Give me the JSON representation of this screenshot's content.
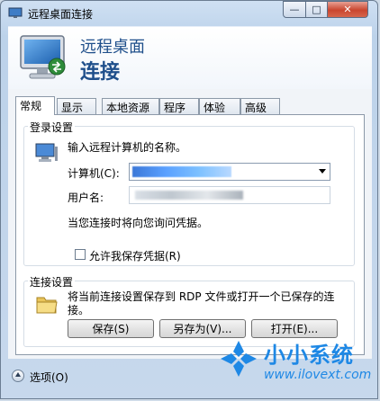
{
  "window": {
    "title": "远程桌面连接",
    "controls": {
      "minimize": "—",
      "maximize": "□",
      "close": "✕"
    }
  },
  "banner": {
    "line1": "远程桌面",
    "line2": "连接",
    "icon": "remote-desktop-monitor-icon"
  },
  "tabs": [
    {
      "label": "常规",
      "active": true
    },
    {
      "label": "显示",
      "active": false
    },
    {
      "label": "本地资源",
      "active": false
    },
    {
      "label": "程序",
      "active": false
    },
    {
      "label": "体验",
      "active": false
    },
    {
      "label": "高级",
      "active": false
    }
  ],
  "logon": {
    "group_label": "登录设置",
    "prompt": "输入远程计算机的名称。",
    "computer_label": "计算机(C):",
    "computer_value": "",
    "username_label": "用户名:",
    "username_value": "",
    "credentials_note": "当您连接时将向您询问凭据。",
    "allow_save_label": "允许我保存凭据(R)",
    "allow_save_checked": false
  },
  "connection": {
    "group_label": "连接设置",
    "description_line1": "将当前连接设置保存到 RDP 文件或打开一个已保存的连",
    "description_line2": "接。",
    "save_button": "保存(S)",
    "save_as_button": "另存为(V)...",
    "open_button": "打开(E)..."
  },
  "footer": {
    "options_label": "选项(O)"
  },
  "watermark": {
    "text": "小小系统",
    "url": "www.ilovext.com"
  },
  "colors": {
    "accent": "#1f4f8b",
    "watermark": "#1e88e5",
    "close_button": "#c9462f"
  }
}
